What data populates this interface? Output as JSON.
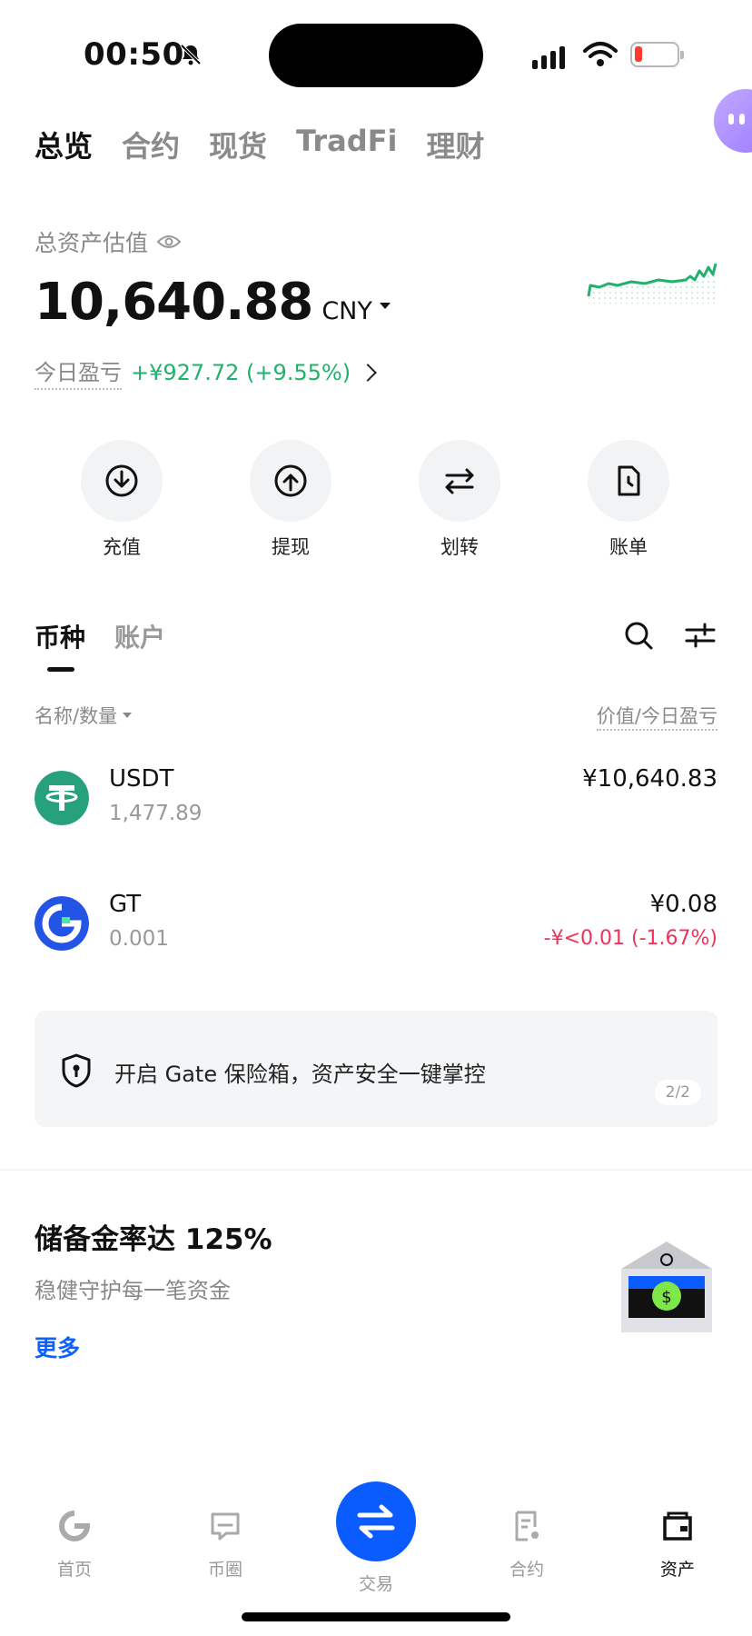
{
  "status_bar": {
    "time": "00:50"
  },
  "top_tabs": [
    "总览",
    "合约",
    "现货",
    "TradFi",
    "理财"
  ],
  "assets": {
    "label": "总资产估值",
    "total": "10,640.88",
    "currency": "CNY",
    "pnl_label": "今日盈亏",
    "pnl_value": "+¥927.72 (+9.55%)"
  },
  "actions": [
    "充值",
    "提现",
    "划转",
    "账单"
  ],
  "sub_tabs": [
    "币种",
    "账户"
  ],
  "list_header": {
    "left": "名称/数量",
    "right": "价值/今日盈亏"
  },
  "coins": [
    {
      "symbol": "USDT",
      "quantity": "1,477.89",
      "value": "¥10,640.83",
      "change": ""
    },
    {
      "symbol": "GT",
      "quantity": "0.001",
      "value": "¥0.08",
      "change": "-¥<0.01 (-1.67%)"
    }
  ],
  "banner": {
    "text": "开启 Gate 保险箱，资产安全一键掌控",
    "pager": "2/2"
  },
  "reserve": {
    "title": "储备金率达 125%",
    "subtitle": "稳健守护每一笔资金",
    "more": "更多"
  },
  "bottom_nav": [
    "首页",
    "币圈",
    "交易",
    "合约",
    "资产"
  ],
  "colors": {
    "profit": "#20b26c",
    "loss": "#f0325a",
    "accent": "#0b5cff",
    "usdt": "#26a17b",
    "gt": "#2354e6"
  }
}
